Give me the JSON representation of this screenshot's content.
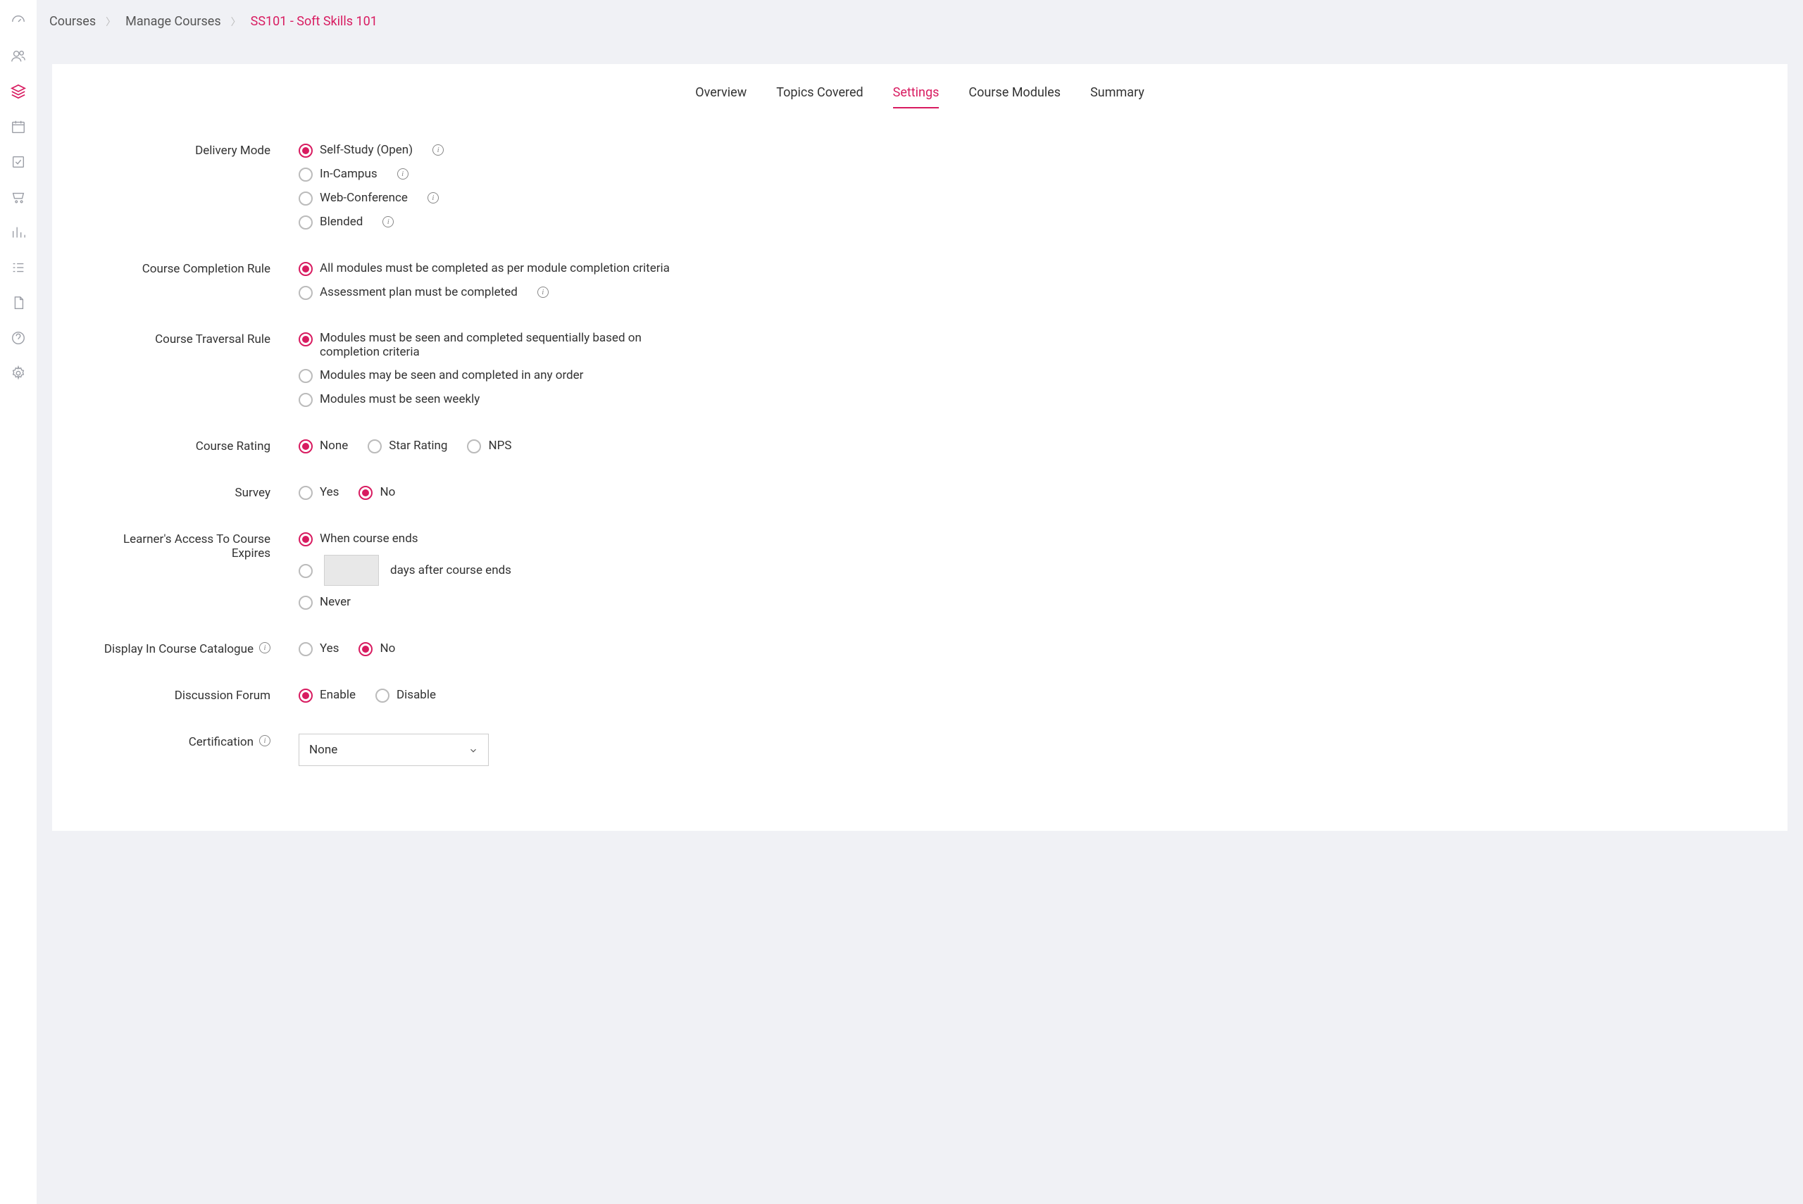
{
  "breadcrumb": {
    "items": [
      "Courses",
      "Manage Courses",
      "SS101 - Soft Skills 101"
    ]
  },
  "tabs": {
    "items": [
      "Overview",
      "Topics Covered",
      "Settings",
      "Course Modules",
      "Summary"
    ],
    "activeIndex": 2
  },
  "settings": {
    "deliveryMode": {
      "label": "Delivery Mode",
      "options": [
        "Self-Study (Open)",
        "In-Campus",
        "Web-Conference",
        "Blended"
      ],
      "selectedIndex": 0
    },
    "completionRule": {
      "label": "Course Completion Rule",
      "options": [
        "All modules must be completed as per module completion criteria",
        "Assessment plan must be completed"
      ],
      "selectedIndex": 0
    },
    "traversalRule": {
      "label": "Course Traversal Rule",
      "options": [
        "Modules must be seen and completed sequentially based on completion criteria",
        "Modules may be seen and completed in any order",
        "Modules must be seen weekly"
      ],
      "selectedIndex": 0
    },
    "courseRating": {
      "label": "Course Rating",
      "options": [
        "None",
        "Star Rating",
        "NPS"
      ],
      "selectedIndex": 0
    },
    "survey": {
      "label": "Survey",
      "options": [
        "Yes",
        "No"
      ],
      "selectedIndex": 1
    },
    "accessExpires": {
      "label": "Learner's Access To Course Expires",
      "options": [
        "When course ends",
        "days after course ends",
        "Never"
      ],
      "daysValue": "",
      "selectedIndex": 0
    },
    "displayCatalogue": {
      "label": "Display In Course Catalogue",
      "options": [
        "Yes",
        "No"
      ],
      "selectedIndex": 1
    },
    "discussionForum": {
      "label": "Discussion Forum",
      "options": [
        "Enable",
        "Disable"
      ],
      "selectedIndex": 0
    },
    "certification": {
      "label": "Certification",
      "value": "None"
    }
  }
}
